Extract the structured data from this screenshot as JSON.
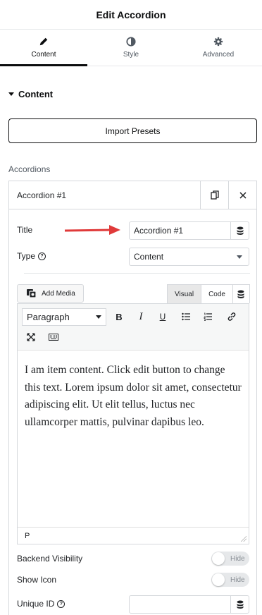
{
  "header": {
    "title": "Edit Accordion"
  },
  "tabs": [
    {
      "label": "Content",
      "icon": "pencil-icon",
      "active": true
    },
    {
      "label": "Style",
      "icon": "half-circle-icon",
      "active": false
    },
    {
      "label": "Advanced",
      "icon": "gear-icon",
      "active": false
    }
  ],
  "section": {
    "label": "Content"
  },
  "import_presets": "Import Presets",
  "accordions_label": "Accordions",
  "item": {
    "title": "Accordion #1",
    "fields": {
      "title_label": "Title",
      "title_value": "Accordion #1",
      "type_label": "Type",
      "type_value": "Content"
    },
    "editor": {
      "add_media": "Add Media",
      "tab_visual": "Visual",
      "tab_code": "Code",
      "format": "Paragraph",
      "content": "I am item content. Click edit button to change this text. Lorem ipsum dolor sit amet, consectetur adipiscing elit. Ut elit tellus, luctus nec ullamcorper mattis, pulvinar dapibus leo.",
      "status_path": "P"
    },
    "backend_visibility_label": "Backend Visibility",
    "backend_visibility_toggle": "Hide",
    "show_icon_label": "Show Icon",
    "show_icon_toggle": "Hide",
    "unique_id_label": "Unique ID",
    "unique_id_value": ""
  },
  "colors": {
    "accent_arrow": "#e03a3a",
    "text": "#1f2124",
    "border": "#d5d8dc"
  }
}
